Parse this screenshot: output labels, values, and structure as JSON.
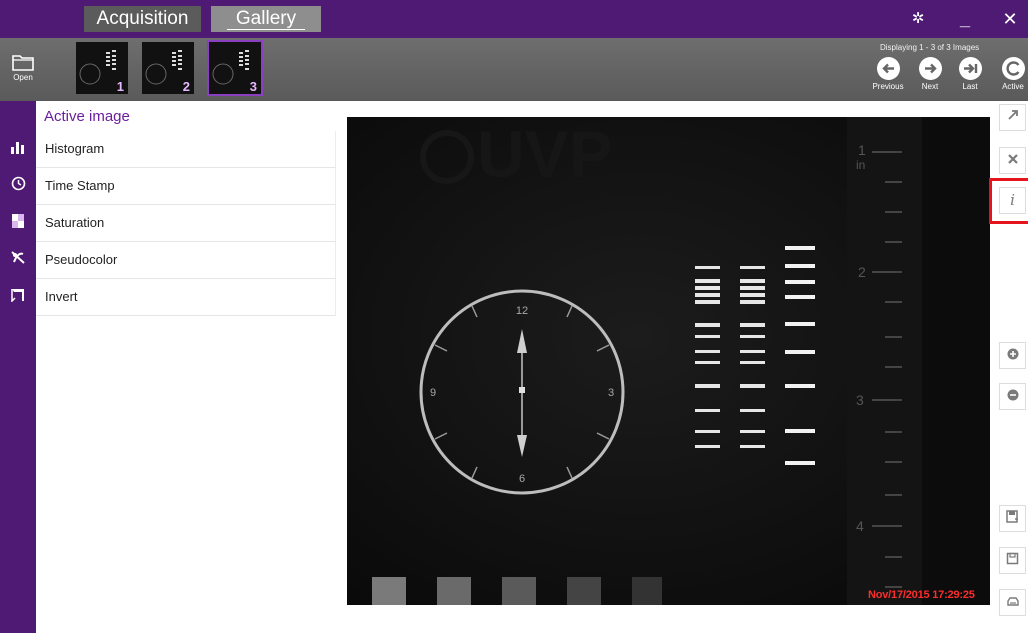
{
  "tabs": {
    "acquisition": "Acquisition",
    "gallery": "Gallery"
  },
  "window_controls": [
    "settings-icon",
    "minimize-icon",
    "close-icon"
  ],
  "toolbar": {
    "open_label": "Open",
    "thumbnails": [
      {
        "number": "1",
        "selected": false
      },
      {
        "number": "2",
        "selected": false
      },
      {
        "number": "3",
        "selected": true
      }
    ],
    "display_status": "Displaying 1 - 3 of 3 Images",
    "nav": {
      "previous": "Previous",
      "next": "Next",
      "last": "Last",
      "active": "Active"
    }
  },
  "panel": {
    "title": "Active image",
    "tools": [
      {
        "label": "Histogram",
        "icon": "histogram-icon"
      },
      {
        "label": "Time Stamp",
        "icon": "clock-icon"
      },
      {
        "label": "Saturation",
        "icon": "saturation-icon"
      },
      {
        "label": "Pseudocolor",
        "icon": "pseudocolor-icon"
      },
      {
        "label": "Invert",
        "icon": "invert-icon"
      }
    ]
  },
  "image": {
    "watermark": "UVP",
    "clock_numbers": [
      "12",
      "3",
      "6",
      "9"
    ],
    "ruler_labels": [
      "1",
      "2",
      "3",
      "4"
    ],
    "ruler_unit": "in",
    "timestamp": "Nov/17/2015 17:29:25"
  },
  "side_tools": [
    "expand-icon",
    "close-image-icon",
    "info-icon",
    "zoom-in-icon",
    "zoom-out-icon",
    "save-as-icon",
    "save-icon",
    "print-icon"
  ],
  "colors": {
    "brand_purple": "#4f1a73",
    "accent_purple": "#6a1f9c",
    "highlight_red": "#e3141b",
    "timestamp_red": "#ff2c2c"
  }
}
